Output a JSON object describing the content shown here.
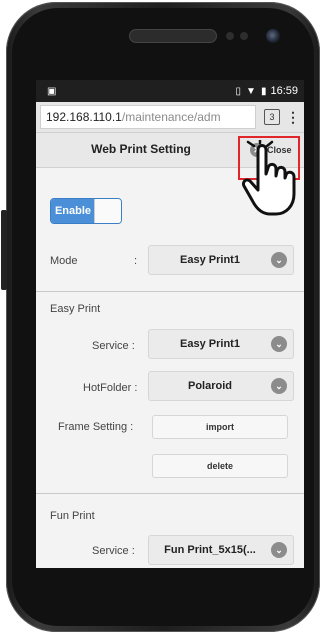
{
  "status_bar": {
    "time": "16:59"
  },
  "browser": {
    "url_host": "192.168.110.1",
    "url_path": "/maintenance/adm",
    "tab_count": "3",
    "menu_label": "⋮"
  },
  "header": {
    "title": "Web Print Setting",
    "close_label": "Close"
  },
  "toggle": {
    "label": "Enable"
  },
  "mode": {
    "label": "Mode",
    "colon": ":",
    "value": "Easy Print1"
  },
  "easy_print": {
    "section_title": "Easy Print",
    "service_label": "Service :",
    "service_value": "Easy Print1",
    "hotfolder_label": "HotFolder :",
    "hotfolder_value": "Polaroid",
    "frame_label": "Frame Setting :",
    "import_label": "import",
    "delete_label": "delete"
  },
  "fun_print": {
    "section_title": "Fun Print",
    "service_label": "Service :",
    "service_value": "Fun Print_5x15(..."
  },
  "colors": {
    "highlight": "#e0262b",
    "toggle_on": "#4a8fd8"
  }
}
